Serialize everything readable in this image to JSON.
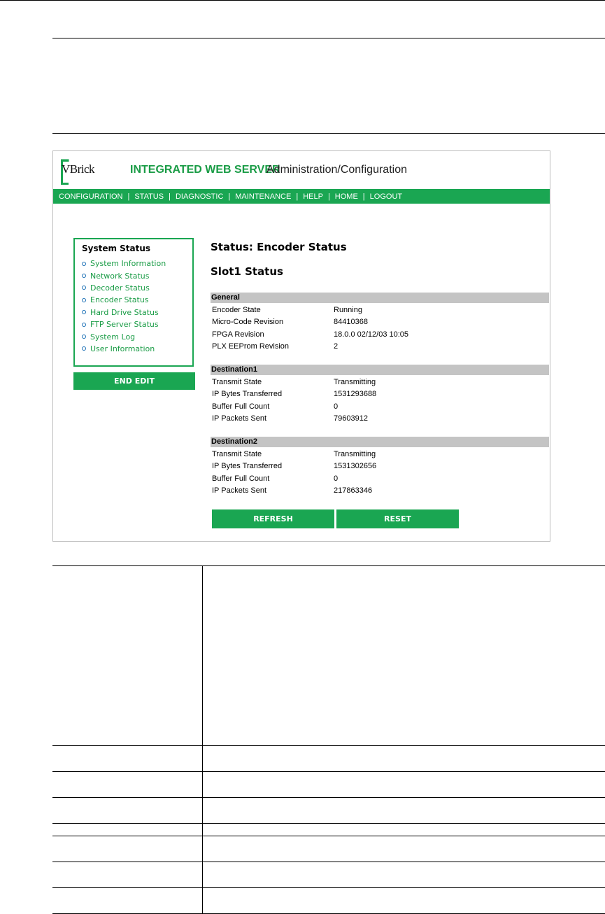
{
  "header": {
    "logo_text": "VBrick",
    "title_main": "INTEGRATED WEB SERVER",
    "title_sub": "Administration/Configuration"
  },
  "nav": [
    "CONFIGURATION",
    "STATUS",
    "DIAGNOSTIC",
    "MAINTENANCE",
    "HELP",
    "HOME",
    "LOGOUT"
  ],
  "sidebar": {
    "title": "System Status",
    "items": [
      "System Information",
      "Network Status",
      "Decoder Status",
      "Encoder Status",
      "Hard Drive Status",
      "FTP Server Status",
      "System Log",
      "User Information"
    ],
    "end_edit": "END EDIT"
  },
  "main": {
    "heading": "Status: Encoder Status",
    "slot_heading": "Slot1 Status",
    "general": {
      "title": "General",
      "rows": [
        {
          "label": "Encoder State",
          "value": "Running"
        },
        {
          "label": "Micro-Code Revision",
          "value": "84410368"
        },
        {
          "label": "FPGA Revision",
          "value": "18.0.0 02/12/03 10:05"
        },
        {
          "label": "PLX EEProm Revision",
          "value": "2"
        }
      ]
    },
    "destination1": {
      "title": "Destination1",
      "rows": [
        {
          "label": "Transmit State",
          "value": "Transmitting"
        },
        {
          "label": "IP Bytes Transferred",
          "value": "1531293688"
        },
        {
          "label": "Buffer Full Count",
          "value": "0"
        },
        {
          "label": "IP Packets Sent",
          "value": "79603912"
        }
      ]
    },
    "destination2": {
      "title": "Destination2",
      "rows": [
        {
          "label": "Transmit State",
          "value": "Transmitting"
        },
        {
          "label": "IP Bytes Transferred",
          "value": "1531302656"
        },
        {
          "label": "Buffer Full Count",
          "value": "0"
        },
        {
          "label": "IP Packets Sent",
          "value": "217863346"
        }
      ]
    },
    "buttons": {
      "refresh": "REFRESH",
      "reset": "RESET"
    }
  },
  "colors": {
    "accent": "#1aa652",
    "section_bar": "#c4c4c4"
  }
}
